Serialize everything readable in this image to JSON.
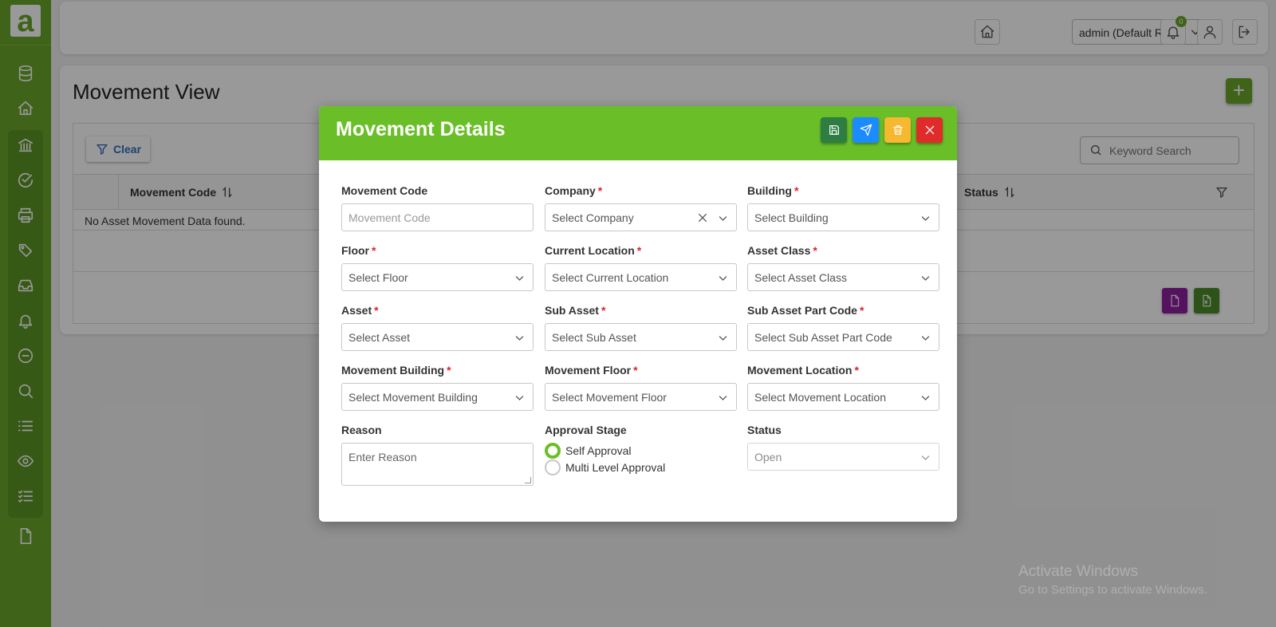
{
  "app": {
    "logo_letter": "a"
  },
  "topbar": {
    "role": "admin (Default Role)",
    "notification_count": "0"
  },
  "page": {
    "title": "Movement View",
    "clear_label": "Clear",
    "search_placeholder": "Keyword Search",
    "columns": [
      "Movement Code",
      "Status"
    ],
    "empty_message": "No Asset Movement Data found."
  },
  "modal": {
    "title": "Movement Details",
    "fields": {
      "movement_code": {
        "label": "Movement Code",
        "placeholder": "Movement Code"
      },
      "company": {
        "label": "Company",
        "placeholder": "Select Company"
      },
      "building": {
        "label": "Building",
        "placeholder": "Select Building"
      },
      "floor": {
        "label": "Floor",
        "placeholder": "Select Floor"
      },
      "current_location": {
        "label": "Current Location",
        "placeholder": "Select Current Location"
      },
      "asset_class": {
        "label": "Asset Class",
        "placeholder": "Select Asset Class"
      },
      "asset": {
        "label": "Asset",
        "placeholder": "Select Asset"
      },
      "sub_asset": {
        "label": "Sub Asset",
        "placeholder": "Select Sub Asset"
      },
      "sub_asset_part_code": {
        "label": "Sub Asset Part Code",
        "placeholder": "Select Sub Asset Part Code"
      },
      "movement_building": {
        "label": "Movement Building",
        "placeholder": "Select Movement Building"
      },
      "movement_floor": {
        "label": "Movement Floor",
        "placeholder": "Select Movement Floor"
      },
      "movement_location": {
        "label": "Movement Location",
        "placeholder": "Select Movement Location"
      },
      "reason": {
        "label": "Reason",
        "placeholder": "Enter Reason"
      },
      "approval_stage": {
        "label": "Approval Stage",
        "options": [
          "Self Approval",
          "Multi Level Approval"
        ],
        "selected": "Self Approval"
      },
      "status": {
        "label": "Status",
        "value": "Open"
      }
    },
    "required_mark": "*"
  },
  "watermark": {
    "line1": "Activate Windows",
    "line2": "Go to Settings to activate Windows."
  },
  "colors": {
    "sidebar": "#68a52a",
    "header": "#6abf28",
    "save": "#2e7d42",
    "submit": "#1a8cff",
    "delete": "#f5b82e",
    "close": "#e02b2b",
    "pdf": "#8e1e9e",
    "excel": "#4e8a2a",
    "required": "#e02424"
  }
}
